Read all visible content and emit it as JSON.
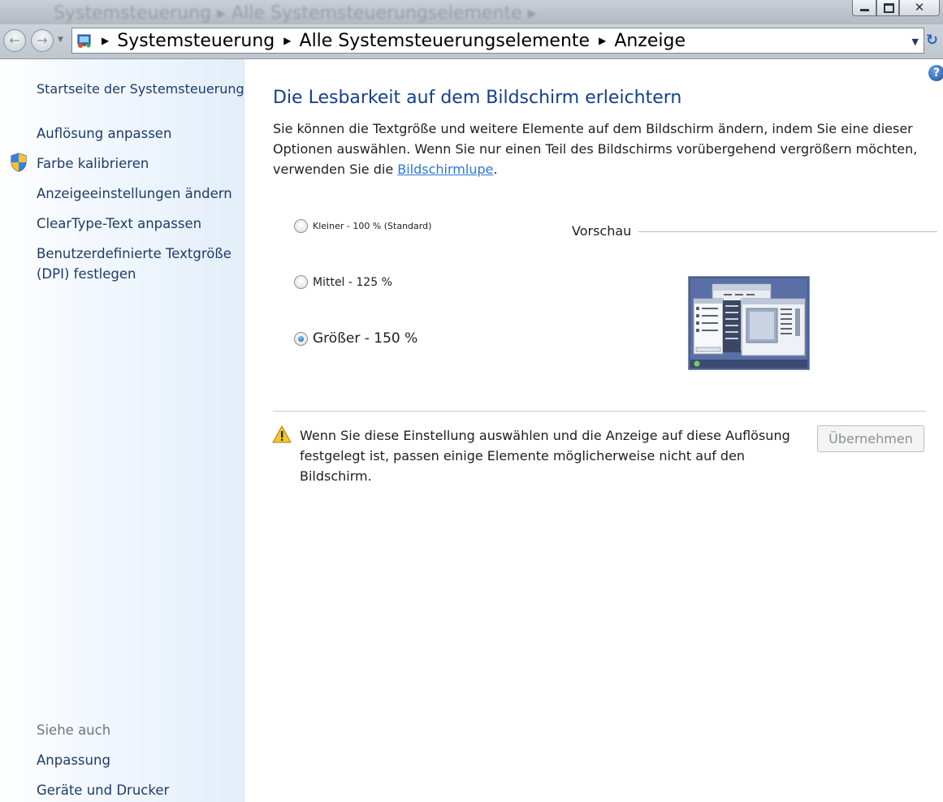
{
  "window": {
    "ghost_title": "Systemsteuerung ▸ Alle Systemsteuerungselemente ▸",
    "close_glyph": "✕"
  },
  "nav": {
    "back_glyph": "←",
    "forward_glyph": "→",
    "dropdown_glyph": "▼",
    "refresh_glyph": "↻"
  },
  "address": {
    "crumbs": [
      "Systemsteuerung",
      "Alle Systemsteuerungselemente",
      "Anzeige"
    ],
    "separator": "▶",
    "dropdown_glyph": "▼"
  },
  "sidebar": {
    "home": "Startseite der Systemsteuerung",
    "items": [
      {
        "label": "Auflösung anpassen"
      },
      {
        "label": "Farbe kalibrieren",
        "icon": "uac-shield-icon"
      },
      {
        "label": "Anzeigeeinstellungen ändern"
      },
      {
        "label": "ClearType-Text anpassen"
      },
      {
        "label": "Benutzerdefinierte Textgröße\n(DPI) festlegen"
      }
    ],
    "see_also_heading": "Siehe auch",
    "see_also": [
      {
        "label": "Anpassung"
      },
      {
        "label": "Geräte und Drucker"
      }
    ]
  },
  "main": {
    "help_glyph": "?",
    "title": "Die Lesbarkeit auf dem Bildschirm erleichtern",
    "intro_text": "Sie können die Textgröße und weitere Elemente auf dem Bildschirm ändern, indem Sie eine dieser Optionen auswählen. Wenn Sie nur einen Teil des Bildschirms vorübergehend vergrößern möchten, verwenden Sie die ",
    "intro_link": "Bildschirmlupe",
    "intro_end": ".",
    "options": [
      {
        "label": "Kleiner - 100 % (Standard)",
        "checked": false
      },
      {
        "label": "Mittel - 125 %",
        "checked": false
      },
      {
        "label": "Größer - 150 %",
        "checked": true
      }
    ],
    "preview_label": "Vorschau",
    "warning_text": "Wenn Sie diese Einstellung auswählen und die Anzeige auf diese Auflösung festgelegt ist, passen einige Elemente möglicherweise nicht auf den Bildschirm.",
    "apply_label": "Übernehmen"
  },
  "colors": {
    "link": "#1e3b6a",
    "title": "#143f8a",
    "hyperlink": "#2a78d4"
  }
}
